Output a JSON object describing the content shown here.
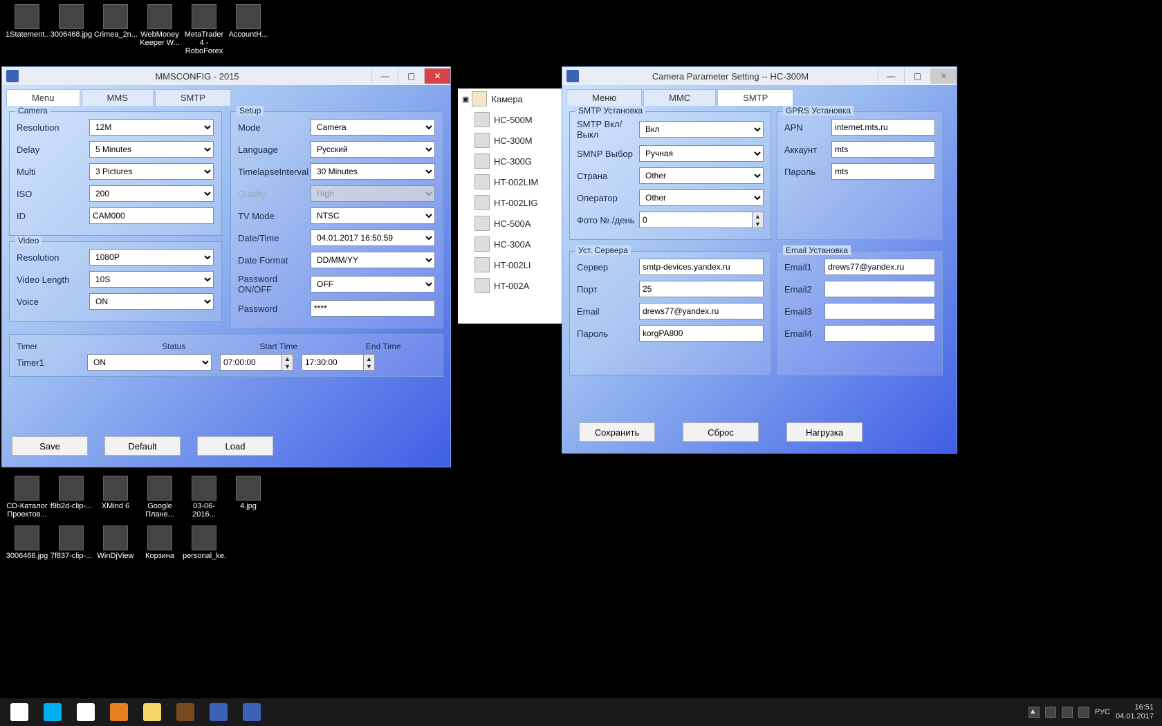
{
  "desktop_row1": [
    {
      "label": "1Statement..."
    },
    {
      "label": "3006468.jpg"
    },
    {
      "label": "Crimea_2n..."
    },
    {
      "label": "WebMoney Keeper W..."
    },
    {
      "label": "MetaTrader 4 - RoboForex"
    },
    {
      "label": "AccountH..."
    }
  ],
  "desktop_row2": [
    {
      "label": "CD-Каталог Проектов..."
    },
    {
      "label": "f9b2d-clip-..."
    },
    {
      "label": "XMind 6"
    },
    {
      "label": "Google Плане..."
    },
    {
      "label": "03-06-2016..."
    },
    {
      "label": "4.jpg"
    }
  ],
  "desktop_row3": [
    {
      "label": "3006466.jpg"
    },
    {
      "label": "7f837-clip-..."
    },
    {
      "label": "WinDjView"
    },
    {
      "label": "Корзина"
    },
    {
      "label": "personal_ke..."
    }
  ],
  "explorer": {
    "root": "Камера",
    "items": [
      "HC-500M",
      "HC-300M",
      "HC-300G",
      "HT-002LIM",
      "HT-002LIG",
      "HC-500A",
      "HC-300A",
      "HT-002LI",
      "HT-002A"
    ]
  },
  "w1": {
    "title": "MMSCONFIG - 2015",
    "tabs": [
      "Menu",
      "MMS",
      "SMTP"
    ],
    "camera": {
      "title": "Camera",
      "resolution_l": "Resolution",
      "resolution": "12M",
      "delay_l": "Delay",
      "delay": "5 Minutes",
      "multi_l": "Multi",
      "multi": "3 Pictures",
      "iso_l": "ISO",
      "iso": "200",
      "id_l": "ID",
      "id": "CAM000"
    },
    "video": {
      "title": "Video",
      "resolution_l": "Resolution",
      "resolution": "1080P",
      "length_l": "Video Length",
      "length": "10S",
      "voice_l": "Voice",
      "voice": "ON"
    },
    "setup": {
      "title": "Setup",
      "mode_l": "Mode",
      "mode": "Camera",
      "lang_l": "Language",
      "lang": "Русский",
      "tl_l": "TimelapseInterval",
      "tl": "30  Minutes",
      "q_l": "Quality",
      "q": "High",
      "tv_l": "TV Mode",
      "tv": "NTSC",
      "dt_l": "Date/Time",
      "dt": "04.01.2017 16:50:59",
      "df_l": "Date Format",
      "df": "DD/MM/YY",
      "pw_on_l": "Password ON/OFF",
      "pw_on": "OFF",
      "pw_l": "Password",
      "pw": "****"
    },
    "timer": {
      "title": "Timer",
      "h1": "Timer",
      "h2": "Status",
      "h3": "Start Time",
      "h4": "End Time",
      "name": "Timer1",
      "status": "ON",
      "start": "07:00:00",
      "end": "17:30:00"
    },
    "btns": {
      "save": "Save",
      "default": "Default",
      "load": "Load"
    }
  },
  "w2": {
    "title": "Camera Parameter Setting -- HC-300M",
    "tabs": [
      "Меню",
      "ММС",
      "SMTP"
    ],
    "smtp": {
      "title": "SMTP Установка",
      "onoff_l": "SMTP Вкл/Выкл",
      "onoff": "Вкл",
      "mode_l": "SMNP Выбор",
      "mode": "Ручная",
      "country_l": "Страна",
      "country": "Other",
      "op_l": "Оператор",
      "op": "Other",
      "photos_l": "Фото №./день",
      "photos": "0"
    },
    "gprs": {
      "title": "GPRS Установка",
      "apn_l": "APN",
      "apn": "internet.mts.ru",
      "acc_l": "Аккаунт",
      "acc": "mts",
      "pw_l": "Пароль",
      "pw": "mts"
    },
    "server": {
      "title": "Уст. Сервера",
      "srv_l": "Сервер",
      "srv": "smtp-devices.yandex.ru",
      "port_l": "Порт",
      "port": "25",
      "email_l": "Email",
      "email": "drews77@yandex.ru",
      "pw_l": "Пароль",
      "pw": "korgPA800"
    },
    "emails": {
      "title": "Email Установка",
      "e1_l": "Email1",
      "e1": "drews77@yandex.ru",
      "e2_l": "Email2",
      "e2": "",
      "e3_l": "Email3",
      "e3": "",
      "e4_l": "Email4",
      "e4": ""
    },
    "btns": {
      "save": "Сохранить",
      "reset": "Сброс",
      "load": "Нагрузка"
    }
  },
  "taskbar": {
    "lang": "РУС",
    "time": "16:51",
    "date": "04.01.2017"
  }
}
